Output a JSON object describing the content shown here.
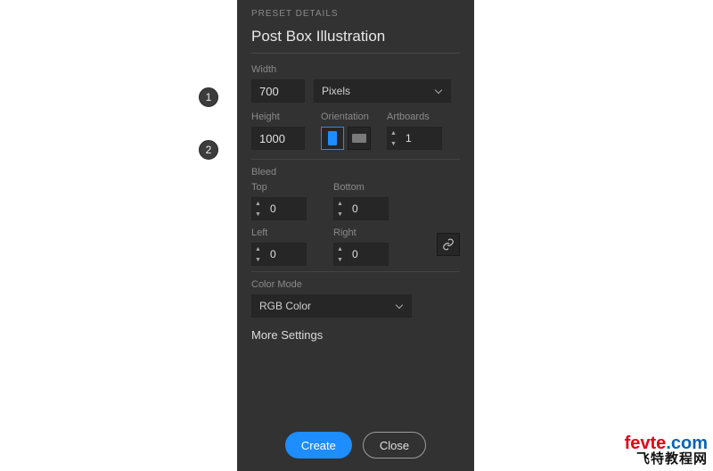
{
  "callouts": {
    "one": "1",
    "two": "2"
  },
  "header": {
    "preset_details": "PRESET DETAILS",
    "title": "Post Box Illustration"
  },
  "width": {
    "label": "Width",
    "value": "700"
  },
  "units": {
    "selected": "Pixels"
  },
  "height": {
    "label": "Height",
    "value": "1000"
  },
  "orientation": {
    "label": "Orientation"
  },
  "artboards": {
    "label": "Artboards",
    "value": "1"
  },
  "bleed": {
    "label": "Bleed",
    "top_label": "Top",
    "top_value": "0",
    "bottom_label": "Bottom",
    "bottom_value": "0",
    "left_label": "Left",
    "left_value": "0",
    "right_label": "Right",
    "right_value": "0"
  },
  "color_mode": {
    "label": "Color Mode",
    "selected": "RGB Color"
  },
  "more_settings": "More Settings",
  "buttons": {
    "create": "Create",
    "close": "Close"
  },
  "watermark": {
    "line1_a": "fevte",
    "line1_b": ".com",
    "line2": "飞特教程网"
  }
}
